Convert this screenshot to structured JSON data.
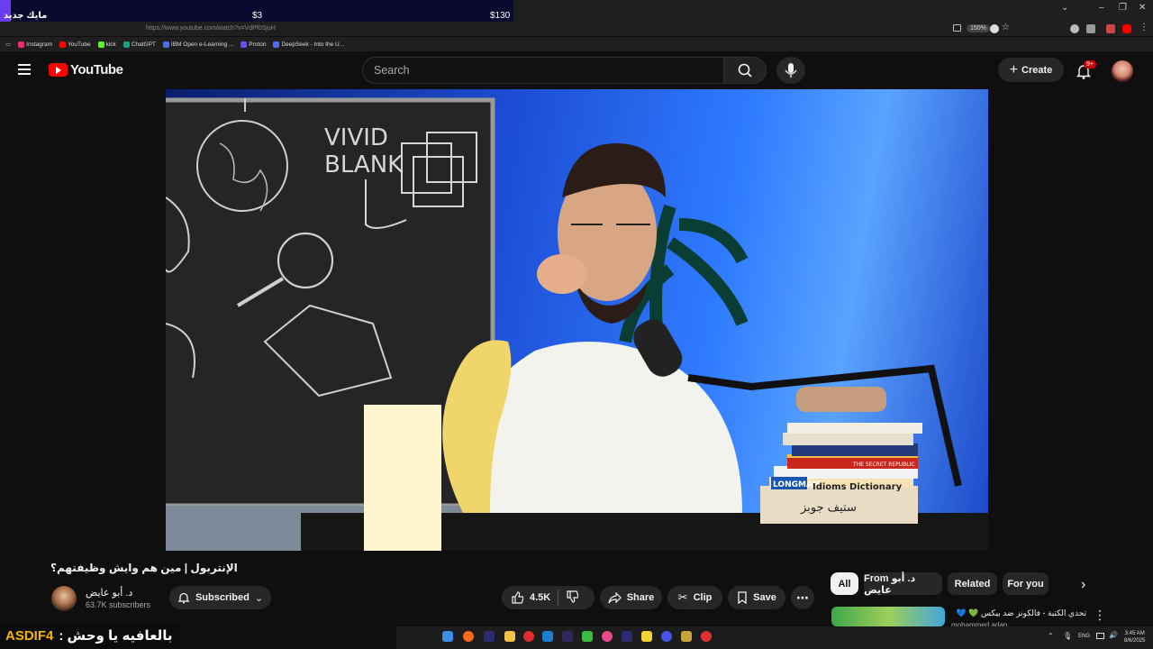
{
  "overlay": {
    "label": "مايك جديد",
    "mid_amount": "$3",
    "right_amount": "$130"
  },
  "browser": {
    "url": "https://www.youtube.com/watch?v=VdPf0SjuH",
    "zoom": "150%"
  },
  "bookmarks": [
    {
      "label": "Instagram",
      "color": "#e1306c"
    },
    {
      "label": "YouTube",
      "color": "#ff0000"
    },
    {
      "label": "kick",
      "color": "#53fc18"
    },
    {
      "label": "ChatGPT",
      "color": "#10a37f"
    },
    {
      "label": "IBM Open e-Learning ...",
      "color": "#4a6cf7"
    },
    {
      "label": "Proton",
      "color": "#6d4aff"
    },
    {
      "label": "DeepSeek - Into the U...",
      "color": "#4d6bfe"
    }
  ],
  "header": {
    "logo_text": "YouTube",
    "search_placeholder": "Search",
    "create_label": "Create",
    "notifications_badge": "9+"
  },
  "video": {
    "board_text_1": "VIVID",
    "board_text_2": "BLANK",
    "book_label": "Idioms Dictionary",
    "book_brand": "LONGMAN",
    "book_red": "THE SECRET REPUBLIC",
    "book_bottom": "ستيف جوبز"
  },
  "info": {
    "title": "الإنتربول | مين هم وايش وظيفتهم؟",
    "channel_name": "د. أبو عايض",
    "subscribers": "63.7K subscribers",
    "subscribed_label": "Subscribed",
    "likes": "4.5K",
    "share_label": "Share",
    "clip_label": "Clip",
    "save_label": "Save"
  },
  "chips": [
    "All",
    "From د. أبو عايض",
    "Related",
    "For you"
  ],
  "recommended": {
    "title": "تحدي الكتبة - فالكونز ضد بيكس 💚 💙",
    "channel": "mohammed adan"
  },
  "stream_overlay": {
    "code": "ASDIF4",
    "message": "بالعافيه يا وحش :"
  },
  "system": {
    "lang": "ENG",
    "time": "3:45 AM",
    "date": "8/6/2025"
  }
}
